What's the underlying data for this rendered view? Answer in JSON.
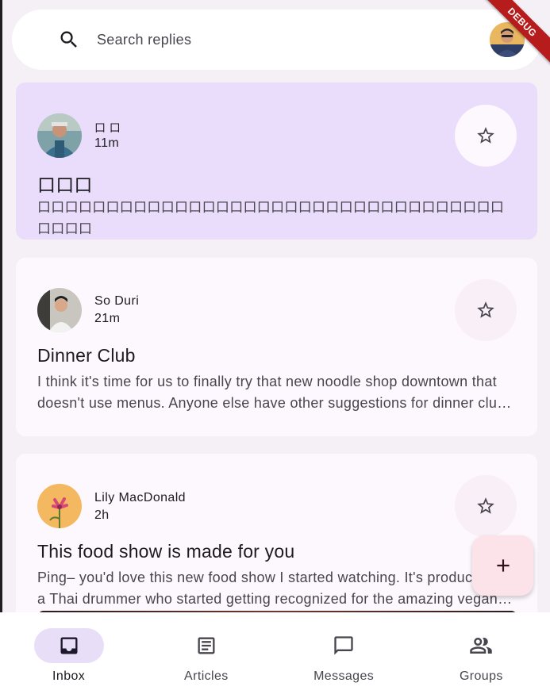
{
  "search": {
    "placeholder": "Search replies",
    "icon": "search-icon"
  },
  "debug_banner": "DEBUG",
  "emails": [
    {
      "sender": "口 口",
      "time": "11m",
      "subject": "口口口",
      "body": "口口口口口口口口口口口口口口口口口口口口口口口口口口口口口口口口口口口口口口",
      "selected": true
    },
    {
      "sender": "So Duri",
      "time": "21m",
      "subject": "Dinner Club",
      "body": "I think it's time for us to finally try that new noodle shop downtown that doesn't use menus. Anyone else have other suggestions for dinner club this week?",
      "selected": false
    },
    {
      "sender": "Lily MacDonald",
      "time": "2h",
      "subject": "This food show is made for you",
      "body": "Ping– you'd love this new food show I started watching. It's produced by a Thai drummer who started getting recognized for the amazing vegan food she always brought to shows.",
      "selected": false
    }
  ],
  "fab": {
    "icon": "add-icon"
  },
  "nav": [
    {
      "label": "Inbox",
      "icon": "inbox-icon",
      "active": true
    },
    {
      "label": "Articles",
      "icon": "article-icon",
      "active": false
    },
    {
      "label": "Messages",
      "icon": "chat-bubble-icon",
      "active": false
    },
    {
      "label": "Groups",
      "icon": "group-icon",
      "active": false
    }
  ],
  "colors": {
    "background": "#f5eff6",
    "selected_card": "#e9ddfb",
    "card": "#fdf8fd",
    "fab": "#fce2e9",
    "nav_indicator": "#e8def8"
  }
}
